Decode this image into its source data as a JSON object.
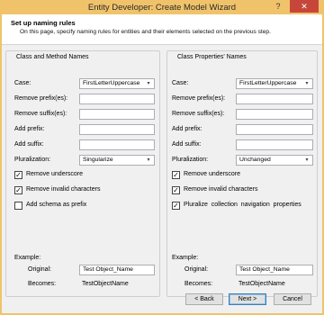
{
  "window": {
    "title": "Entity Developer: Create Model Wizard",
    "help_glyph": "?",
    "close_glyph": "✕"
  },
  "header": {
    "title": "Set up naming rules",
    "description": "On this page, specify naming rules for entities and their elements selected on the previous step."
  },
  "left_panel": {
    "title": "Class and Method Names",
    "case_label": "Case:",
    "case_value": "FirstLetterUppercase",
    "remove_prefix_label": "Remove prefix(es):",
    "remove_prefix_value": "",
    "remove_suffix_label": "Remove suffix(es):",
    "remove_suffix_value": "",
    "add_prefix_label": "Add prefix:",
    "add_prefix_value": "",
    "add_suffix_label": "Add suffix:",
    "add_suffix_value": "",
    "pluralization_label": "Pluralization:",
    "pluralization_value": "Singularize",
    "checkboxes": [
      {
        "label": "Remove underscore",
        "checked": true
      },
      {
        "label": "Remove invalid characters",
        "checked": true
      },
      {
        "label": "Add schema as prefix",
        "checked": false
      }
    ],
    "example_label": "Example:",
    "original_label": "Original:",
    "original_value": "Test Object_Name",
    "becomes_label": "Becomes:",
    "becomes_value": "TestObjectName"
  },
  "right_panel": {
    "title": "Class Properties' Names",
    "case_label": "Case:",
    "case_value": "FirstLetterUppercase",
    "remove_prefix_label": "Remove prefix(es):",
    "remove_prefix_value": "",
    "remove_suffix_label": "Remove suffix(es):",
    "remove_suffix_value": "",
    "add_prefix_label": "Add prefix:",
    "add_prefix_value": "",
    "add_suffix_label": "Add suffix:",
    "add_suffix_value": "",
    "pluralization_label": "Pluralization:",
    "pluralization_value": "Unchanged",
    "checkboxes": [
      {
        "label": "Remove underscore",
        "checked": true
      },
      {
        "label": "Remove invalid characters",
        "checked": true
      },
      {
        "label": "Pluralize  collection  navigation  properties",
        "checked": true
      }
    ],
    "example_label": "Example:",
    "original_label": "Original:",
    "original_value": "Test Object_Name",
    "becomes_label": "Becomes:",
    "becomes_value": "TestObjectName"
  },
  "buttons": {
    "back": "< Back",
    "next": "Next >",
    "cancel": "Cancel"
  },
  "check_glyph": "✓",
  "combo_arrow_glyph": "▾",
  "colors": {
    "title_bar": "#f0c36b",
    "close_button": "#c7463a",
    "dialog_background": "#f0f0f0"
  }
}
